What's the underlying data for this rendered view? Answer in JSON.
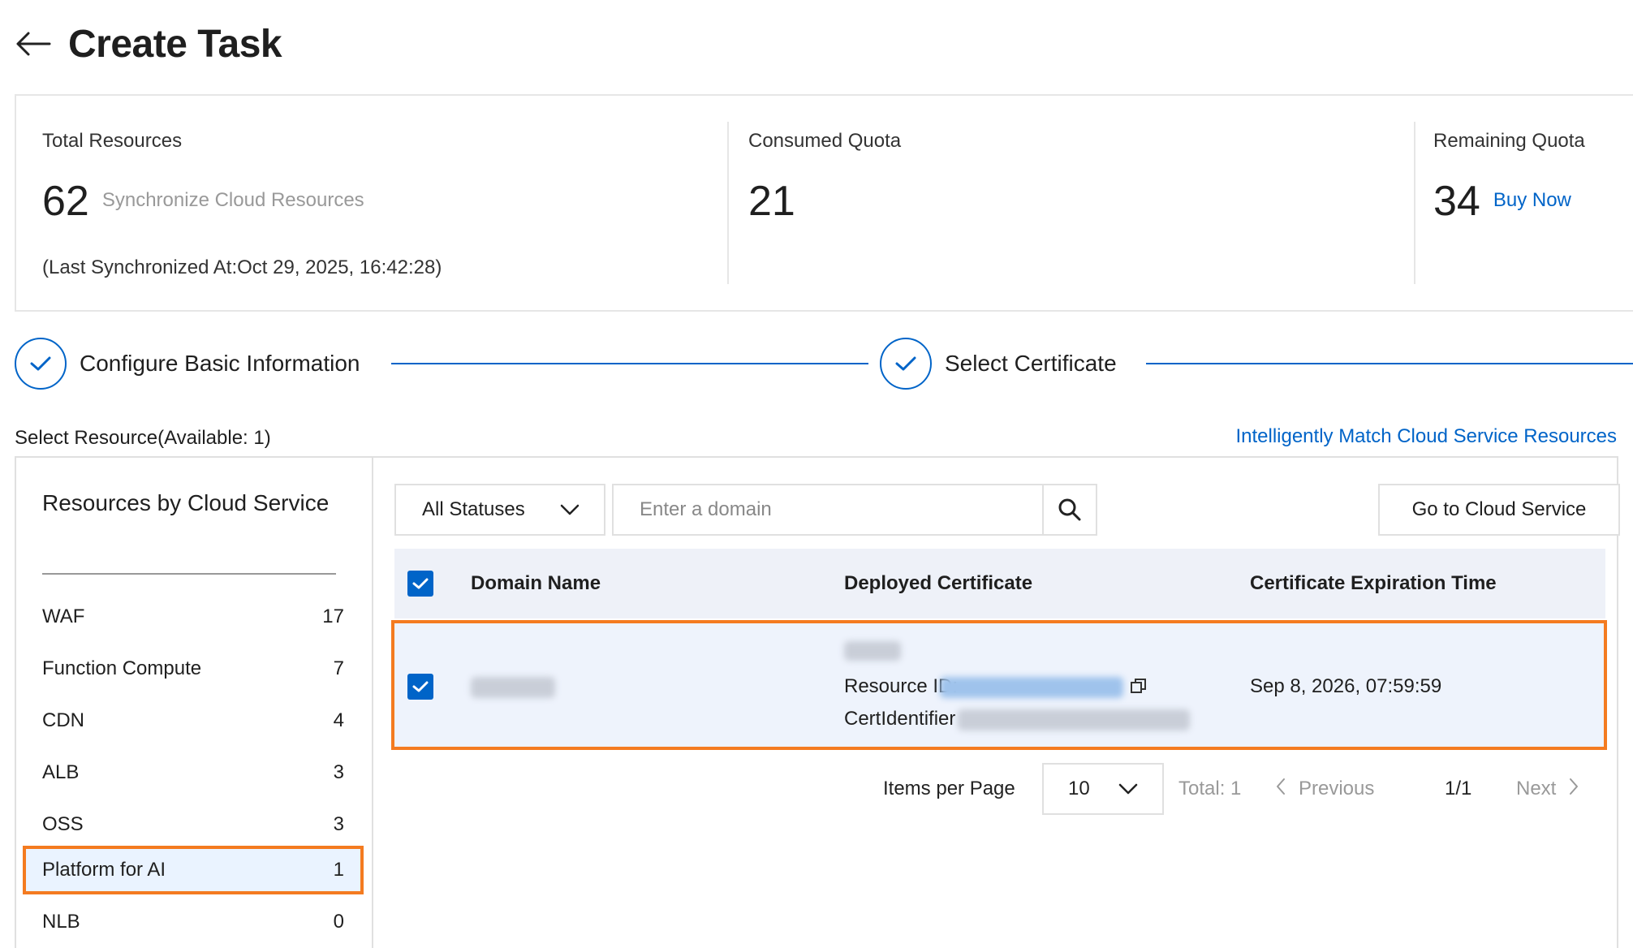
{
  "header": {
    "title": "Create Task"
  },
  "stats": {
    "total": {
      "label": "Total Resources",
      "value": "62",
      "action": "Synchronize Cloud Resources",
      "note": "(Last Synchronized At:Oct 29, 2025, 16:42:28)"
    },
    "consumed": {
      "label": "Consumed Quota",
      "value": "21"
    },
    "remaining": {
      "label": "Remaining Quota",
      "value": "34",
      "action": "Buy Now"
    }
  },
  "steps": [
    {
      "label": "Configure Basic Information",
      "done": true
    },
    {
      "label": "Select Certificate",
      "done": true
    }
  ],
  "resource": {
    "title": "Select Resource(Available: 1)",
    "match_link": "Intelligently Match Cloud Service Resources",
    "sidebar": {
      "title": "Resources by Cloud Service",
      "items": [
        {
          "name": "WAF",
          "count": "17"
        },
        {
          "name": "Function Compute",
          "count": "7"
        },
        {
          "name": "CDN",
          "count": "4"
        },
        {
          "name": "ALB",
          "count": "3"
        },
        {
          "name": "OSS",
          "count": "3"
        },
        {
          "name": "Platform for AI",
          "count": "1",
          "selected": true
        },
        {
          "name": "NLB",
          "count": "0"
        }
      ]
    },
    "filter": {
      "status": "All Statuses",
      "search_placeholder": "Enter a domain",
      "go_button": "Go to Cloud Service"
    },
    "table": {
      "columns": [
        "Domain Name",
        "Deployed Certificate",
        "Certificate Expiration Time"
      ],
      "rows": [
        {
          "checked": true,
          "resource_id_label": "Resource ID:",
          "cert_identifier_label": "CertIdentifier",
          "expiration": "Sep 8, 2026, 07:59:59"
        }
      ]
    },
    "pagination": {
      "items_per_page_label": "Items per Page",
      "page_size": "10",
      "total": "Total: 1",
      "previous": "Previous",
      "page": "1/1",
      "next": "Next"
    }
  },
  "colors": {
    "primary": "#0064c8",
    "highlight": "#f47b20",
    "table_header_bg": "#eef1f8",
    "selected_bg": "#eaf3ff"
  }
}
